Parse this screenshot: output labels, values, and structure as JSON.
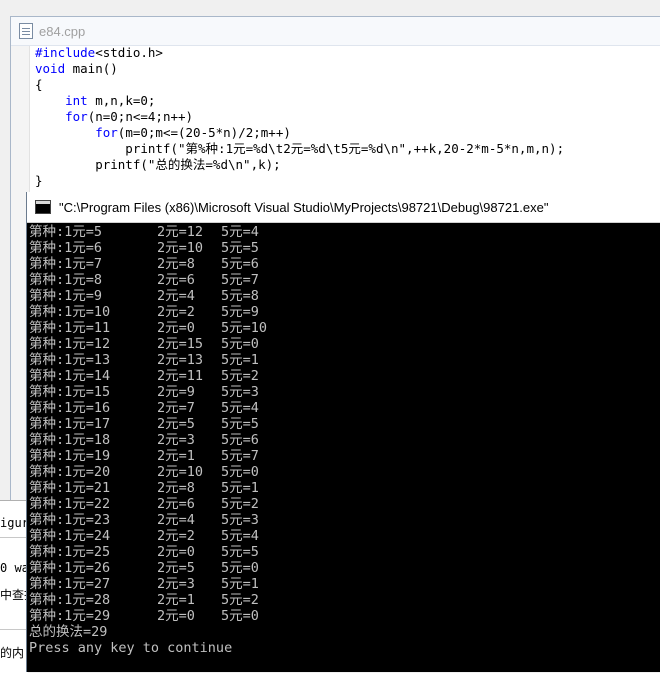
{
  "editor": {
    "title": "e84.cpp",
    "code_lines": [
      {
        "kw": "#include",
        "rest": "<stdio.h>"
      },
      {
        "kw": "void",
        "rest": " main()"
      },
      {
        "kw": "",
        "rest": "{"
      },
      {
        "kw": "",
        "rest": "    ",
        "kw2": "int",
        "rest2": " m,n,k=0;"
      },
      {
        "kw": "",
        "rest": "    ",
        "kw2": "for",
        "rest2": "(n=0;n<=4;n++)"
      },
      {
        "kw": "",
        "rest": "        ",
        "kw2": "for",
        "rest2": "(m=0;m<=(20-5*n)/2;m++)"
      },
      {
        "kw": "",
        "rest": "            printf(\"第%种:1元=%d\\t2元=%d\\t5元=%d\\n\",++k,20-2*m-5*n,m,n);"
      },
      {
        "kw": "",
        "rest": "        printf(\"总的换法=%d\\n\",k);"
      },
      {
        "kw": "",
        "rest": "}"
      }
    ]
  },
  "left_pane": {
    "line1": "igur",
    "line2": "0 wa",
    "line3": "中查找",
    "line4": "的内"
  },
  "console": {
    "title": "\"C:\\Program Files (x86)\\Microsoft Visual Studio\\MyProjects\\98721\\Debug\\98721.exe\"",
    "rows": [
      [
        "第种:1元=5",
        "2元=12",
        "5元=4"
      ],
      [
        "第种:1元=6",
        "2元=10",
        "5元=5"
      ],
      [
        "第种:1元=7",
        "2元=8",
        "5元=6"
      ],
      [
        "第种:1元=8",
        "2元=6",
        "5元=7"
      ],
      [
        "第种:1元=9",
        "2元=4",
        "5元=8"
      ],
      [
        "第种:1元=10",
        "2元=2",
        "5元=9"
      ],
      [
        "第种:1元=11",
        "2元=0",
        "5元=10"
      ],
      [
        "第种:1元=12",
        "2元=15",
        "5元=0"
      ],
      [
        "第种:1元=13",
        "2元=13",
        "5元=1"
      ],
      [
        "第种:1元=14",
        "2元=11",
        "5元=2"
      ],
      [
        "第种:1元=15",
        "2元=9",
        "5元=3"
      ],
      [
        "第种:1元=16",
        "2元=7",
        "5元=4"
      ],
      [
        "第种:1元=17",
        "2元=5",
        "5元=5"
      ],
      [
        "第种:1元=18",
        "2元=3",
        "5元=6"
      ],
      [
        "第种:1元=19",
        "2元=1",
        "5元=7"
      ],
      [
        "第种:1元=20",
        "2元=10",
        "5元=0"
      ],
      [
        "第种:1元=21",
        "2元=8",
        "5元=1"
      ],
      [
        "第种:1元=22",
        "2元=6",
        "5元=2"
      ],
      [
        "第种:1元=23",
        "2元=4",
        "5元=3"
      ],
      [
        "第种:1元=24",
        "2元=2",
        "5元=4"
      ],
      [
        "第种:1元=25",
        "2元=0",
        "5元=5"
      ],
      [
        "第种:1元=26",
        "2元=5",
        "5元=0"
      ],
      [
        "第种:1元=27",
        "2元=3",
        "5元=1"
      ],
      [
        "第种:1元=28",
        "2元=1",
        "5元=2"
      ],
      [
        "第种:1元=29",
        "2元=0",
        "5元=0"
      ]
    ],
    "total_line": "总的换法=29",
    "prompt_line": "Press any key to continue"
  }
}
